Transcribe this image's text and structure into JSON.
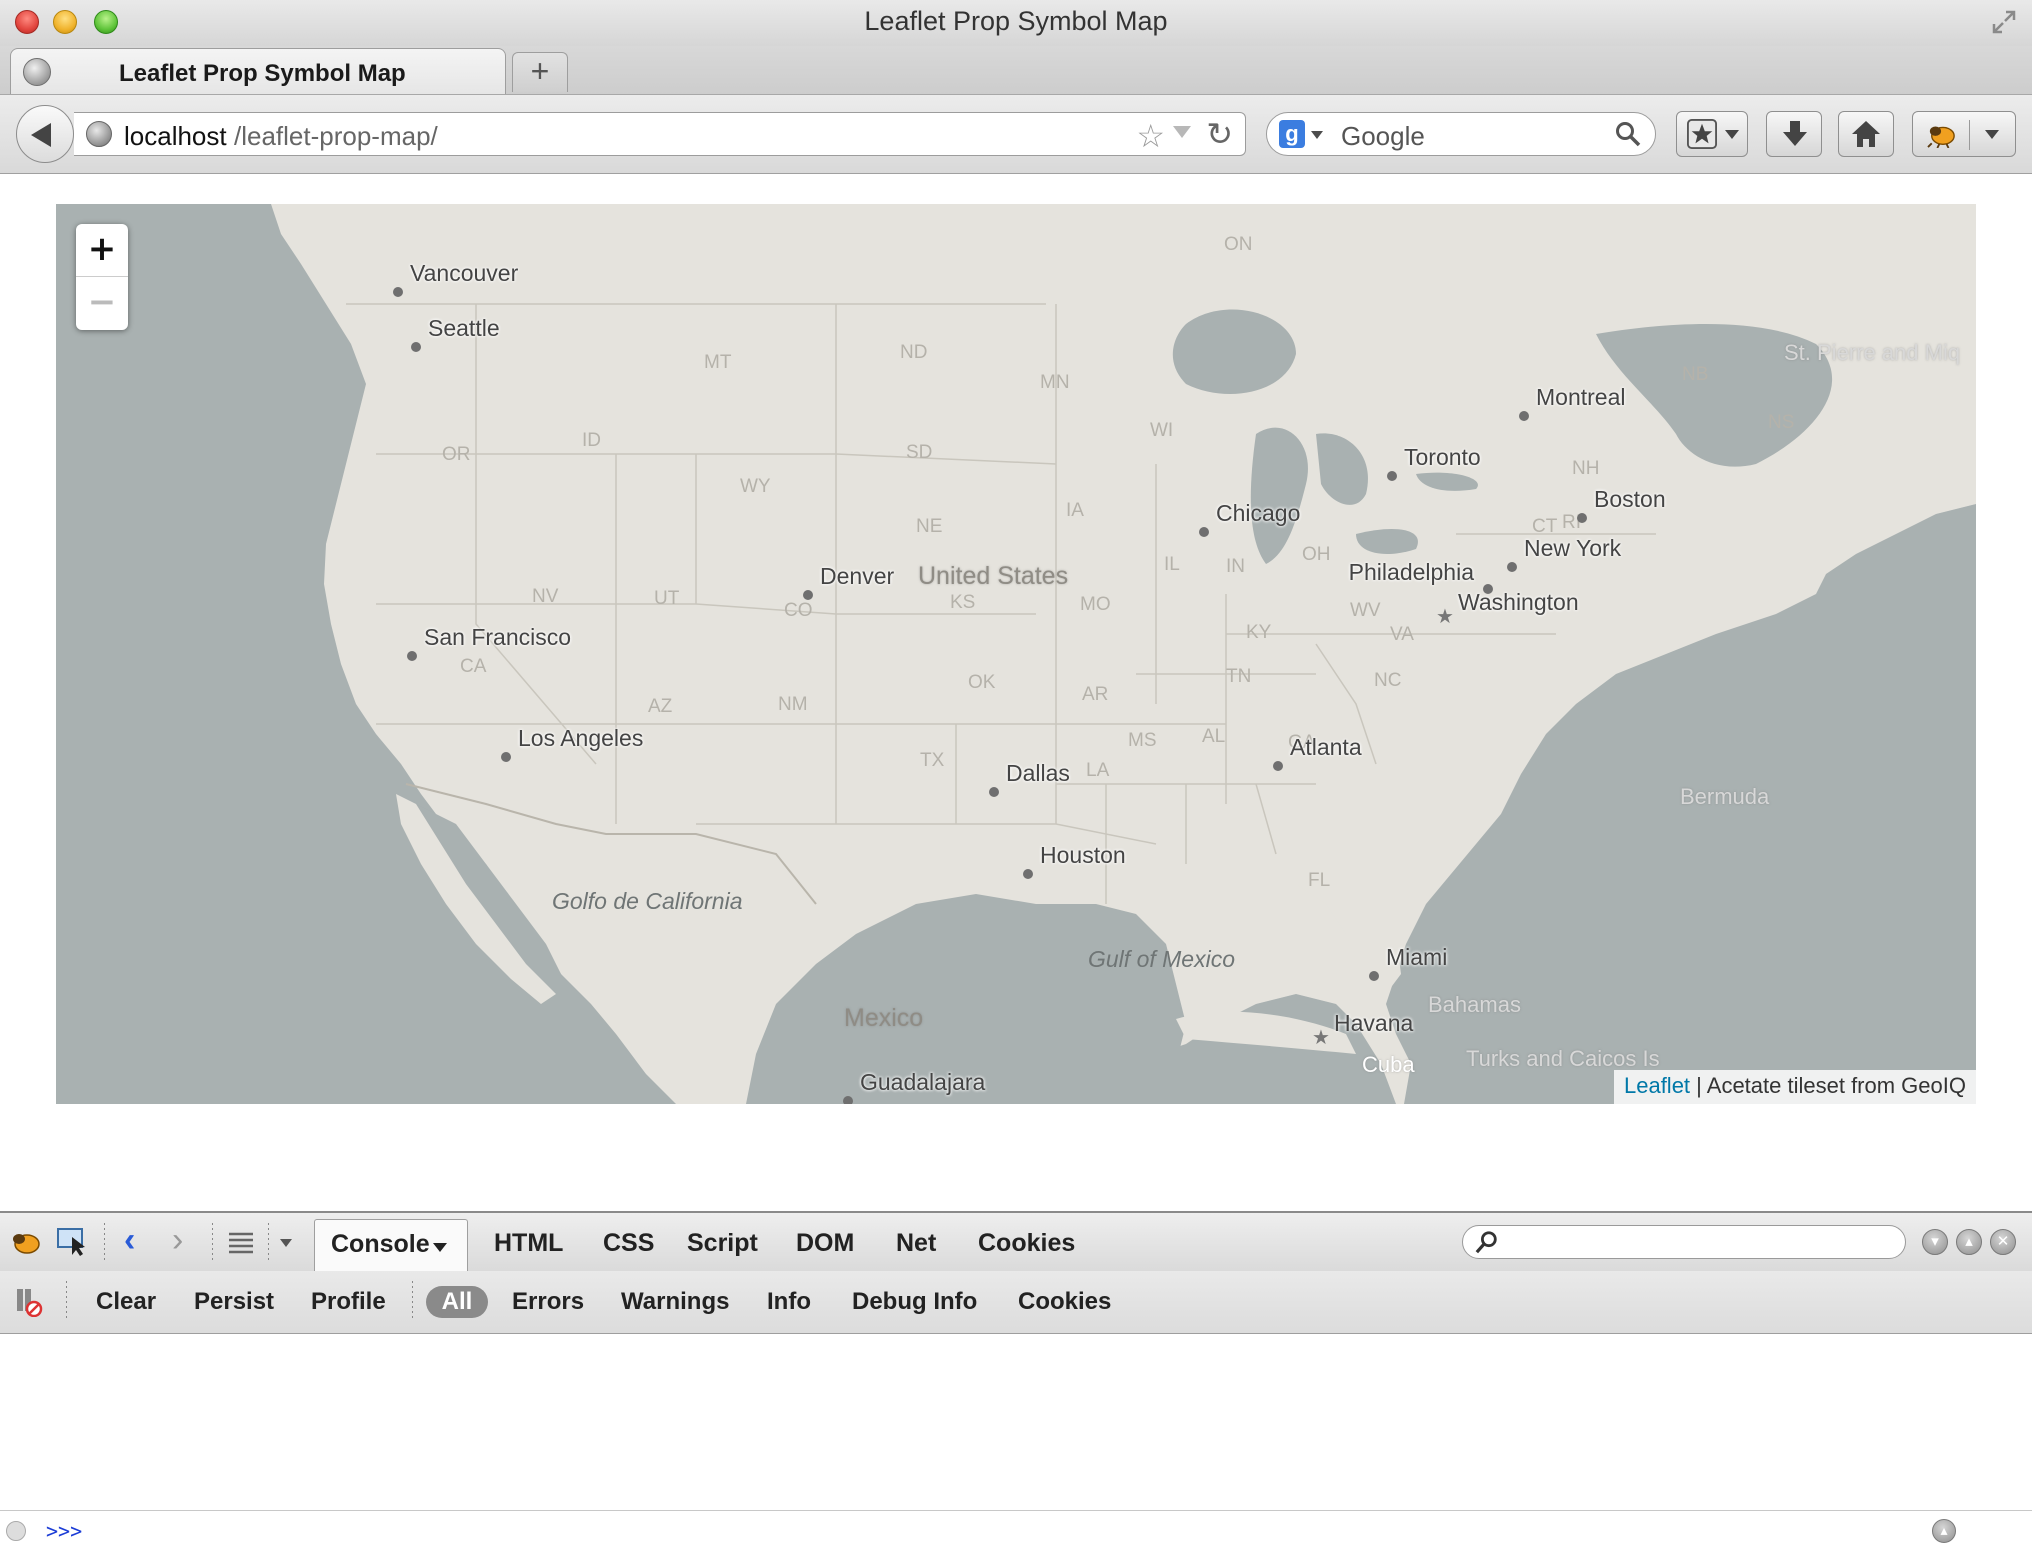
{
  "window": {
    "title": "Leaflet Prop Symbol Map"
  },
  "tabs": [
    {
      "label": "Leaflet Prop Symbol Map",
      "active": true
    }
  ],
  "newtab_label": "+",
  "navbar": {
    "url_host": "localhost",
    "url_path": "/leaflet-prop-map/",
    "search_placeholder": "Google",
    "search_engine_glyph": "g"
  },
  "map": {
    "zoom_in_label": "+",
    "zoom_out_label": "−",
    "attribution_link": "Leaflet",
    "attribution_text": " | Acetate tileset from GeoIQ",
    "cities": [
      {
        "name": "Vancouver",
        "marker": "dot"
      },
      {
        "name": "Seattle",
        "marker": "dot"
      },
      {
        "name": "San Francisco",
        "marker": "dot"
      },
      {
        "name": "Los Angeles",
        "marker": "dot"
      },
      {
        "name": "Denver",
        "marker": "dot"
      },
      {
        "name": "Dallas",
        "marker": "dot"
      },
      {
        "name": "Houston",
        "marker": "dot"
      },
      {
        "name": "Chicago",
        "marker": "dot"
      },
      {
        "name": "Toronto",
        "marker": "dot"
      },
      {
        "name": "Montreal",
        "marker": "dot"
      },
      {
        "name": "Boston",
        "marker": "dot"
      },
      {
        "name": "New York",
        "marker": "dot"
      },
      {
        "name": "Philadelphia",
        "marker": "dot"
      },
      {
        "name": "Washington",
        "marker": "star"
      },
      {
        "name": "Atlanta",
        "marker": "dot"
      },
      {
        "name": "Miami",
        "marker": "dot"
      },
      {
        "name": "Havana",
        "marker": "star"
      },
      {
        "name": "Guadalajara",
        "marker": "dot"
      }
    ],
    "states": [
      "MT",
      "ND",
      "MN",
      "WI",
      "OR",
      "ID",
      "SD",
      "WY",
      "NE",
      "IA",
      "NV",
      "UT",
      "CO",
      "KS",
      "MO",
      "IL",
      "IN",
      "OH",
      "KY",
      "WV",
      "VA",
      "CA",
      "AZ",
      "NM",
      "OK",
      "AR",
      "TN",
      "NC",
      "MS",
      "AL",
      "GA",
      "TX",
      "LA",
      "FL",
      "ON",
      "NB",
      "NH",
      "CT",
      "NS",
      "RI"
    ],
    "regions": [
      "United States",
      "Mexico",
      "Cuba",
      "Bahamas",
      "Bermuda",
      "St. Pierre and Miq",
      "Turks and Caicos Is"
    ],
    "water": [
      "Golfo de California",
      "Gulf of Mexico"
    ]
  },
  "firebug": {
    "tabs": [
      "Console",
      "HTML",
      "CSS",
      "Script",
      "DOM",
      "Net",
      "Cookies"
    ],
    "sub_actions": [
      "Clear",
      "Persist",
      "Profile"
    ],
    "filters": [
      "All",
      "Errors",
      "Warnings",
      "Info",
      "Debug Info",
      "Cookies"
    ],
    "prompt": ">>>"
  },
  "colors": {
    "land": "#e5e3dd",
    "water": "#a9b1b1",
    "link": "#0078a8",
    "prompt": "#1c3dd6"
  }
}
